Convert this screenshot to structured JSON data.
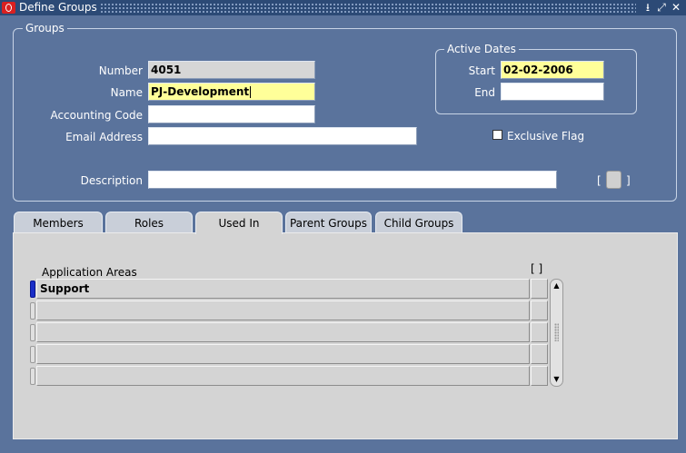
{
  "window": {
    "title": "Define Groups",
    "controls": [
      "minimize-icon",
      "maximize-icon",
      "close-icon"
    ]
  },
  "groups_section": {
    "legend": "Groups",
    "number": {
      "label": "Number",
      "value": "4051"
    },
    "name": {
      "label": "Name",
      "value": "PJ-Development"
    },
    "accounting_code": {
      "label": "Accounting Code",
      "value": ""
    },
    "email_address": {
      "label": "Email Address",
      "value": ""
    },
    "description": {
      "label": "Description",
      "value": ""
    },
    "exclusive_flag": {
      "label": "Exclusive Flag",
      "checked": false
    },
    "dff_brackets": {
      "open": "[",
      "close": "]"
    }
  },
  "active_dates": {
    "legend": "Active Dates",
    "start": {
      "label": "Start",
      "value": "02-02-2006"
    },
    "end": {
      "label": "End",
      "value": ""
    }
  },
  "tabs": [
    {
      "label": "Members",
      "active": false
    },
    {
      "label": "Roles",
      "active": false
    },
    {
      "label": "Used In",
      "active": true
    },
    {
      "label": "Parent Groups",
      "active": false
    },
    {
      "label": "Child Groups",
      "active": false
    }
  ],
  "used_in_grid": {
    "column_header": "Application Areas",
    "dff_header": "[ ]",
    "rows": [
      "Support",
      "",
      "",
      "",
      ""
    ]
  },
  "colors": {
    "canvas": "#5a739c",
    "titlebar": "#2c4a76",
    "required_field": "#ffff99",
    "read_only_field": "#d6d6d6",
    "current_record_indicator": "#1a2ec8"
  }
}
